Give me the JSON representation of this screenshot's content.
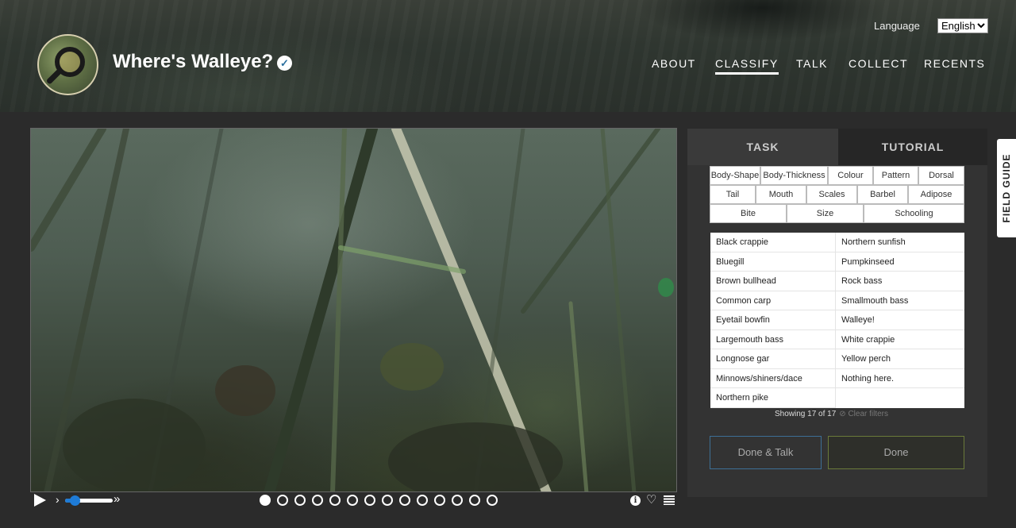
{
  "header": {
    "site_title": "Where's Walleye?",
    "language_label": "Language",
    "language_value": "English",
    "nav": [
      {
        "label": "ABOUT",
        "active": false
      },
      {
        "label": "CLASSIFY",
        "active": true
      },
      {
        "label": "TALK",
        "active": false
      },
      {
        "label": "COLLECT",
        "active": false
      },
      {
        "label": "RECENTS",
        "active": false
      }
    ]
  },
  "player": {
    "play_icon": "play-icon",
    "speed_fraction": 0.2,
    "frames_total": 14,
    "frame_current": 1
  },
  "panel": {
    "tabs": {
      "task": "TASK",
      "tutorial": "TUTORIAL"
    },
    "filters": [
      [
        "Body-Shape",
        "Body-Thickness",
        "Colour",
        "Pattern",
        "Dorsal"
      ],
      [
        "Tail",
        "Mouth",
        "Scales",
        "Barbel",
        "Adipose"
      ],
      [
        "Bite",
        "Size",
        "Schooling"
      ]
    ],
    "choices_col1": [
      "Black crappie",
      "Bluegill",
      "Brown bullhead",
      "Common carp",
      "Eyetail bowfin",
      "Largemouth bass",
      "Longnose gar",
      "Minnows/shiners/dace",
      "Northern pike"
    ],
    "choices_col2": [
      "Northern sunfish",
      "Pumpkinseed",
      "Rock bass",
      "Smallmouth bass",
      "Walleye!",
      "White crappie",
      "Yellow perch",
      "Nothing here."
    ],
    "showing": "Showing 17 of 17",
    "clear_filters": "⊘ Clear filters",
    "done_talk": "Done & Talk",
    "done": "Done"
  },
  "field_guide": "FIELD GUIDE",
  "colors": {
    "accent_blue": "#1e7bd6",
    "done_talk_border": "#3d6f95",
    "done_border": "#6a7a3a"
  }
}
